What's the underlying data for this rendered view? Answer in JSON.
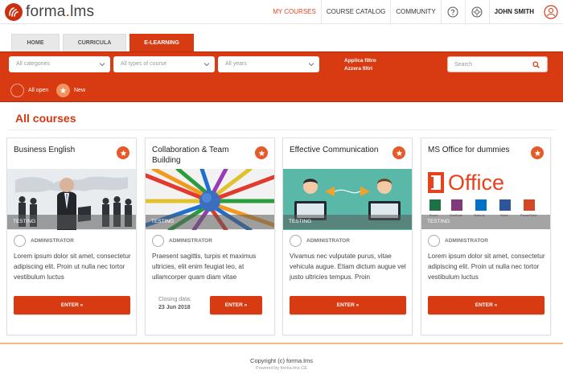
{
  "app": {
    "logo_prefix": "forma",
    "logo_dot": ".",
    "logo_suffix": "lms"
  },
  "nav": {
    "my_courses": "MY COURSES",
    "catalog": "COURSE CATALOG",
    "community": "COMMUNITY",
    "user": "JOHN SMITH",
    "icons": [
      "help-icon",
      "gear-icon",
      "user-icon"
    ]
  },
  "tabs": [
    {
      "label": "HOME",
      "active": false
    },
    {
      "label": "CURRICULA",
      "active": false
    },
    {
      "label": "E-LEARNING",
      "active": true
    }
  ],
  "filters": {
    "categories": "All categories",
    "types": "All types of course",
    "years": "All years",
    "apply": "Applica filtro",
    "reset": "Azzera filtri",
    "search_placeholder": "Search",
    "toggle_open": "All open",
    "toggle_new": "New"
  },
  "section_title": "All courses",
  "courses": [
    {
      "title": "Business English",
      "tag": "TESTING",
      "author": "ADMINISTRATOR",
      "description": "Lorem ipsum dolor sit amet, consectetur adipiscing elit. Proin ut nulla nec tortor vestibulum luctus",
      "button": "ENTER »"
    },
    {
      "title": "Collaboration & Team Building",
      "tag": "TESTING",
      "author": "ADMINISTRATOR",
      "description": "Praesent sagittis, turpis et maximus ultricies, elit enim feugiat leo, at ullamcorper quam diam vitae",
      "closing_label": "Closing data:",
      "closing_date": "23 Jun 2018",
      "button": "ENTER »"
    },
    {
      "title": "Effective Communication",
      "tag": "TESTING",
      "author": "ADMINISTRATOR",
      "description": "Vivamus nec vulputate purus, vitae vehicula augue. Etiam dictum augue vel justo ultricies tempus. Proin",
      "button": "ENTER »"
    },
    {
      "title": "MS Office for dummies",
      "tag": "TESTING",
      "author": "ADMINISTRATOR",
      "description": "Lorem ipsum dolor sit amet, consectetur adipiscing elit. Proin ut nulla nec tortor vestibulum luctus",
      "button": "ENTER »",
      "image_text": "Office",
      "app_labels": [
        "Excel",
        "OneNote",
        "Outlook",
        "Word",
        "PowerPoint"
      ]
    }
  ],
  "footer": {
    "copyright": "Copyright (c) forma.lms",
    "powered": "Powered by forma.lms CE"
  },
  "colors": {
    "brand": "#d83a12",
    "accent": "#e65a2a",
    "title": "#d63611"
  }
}
